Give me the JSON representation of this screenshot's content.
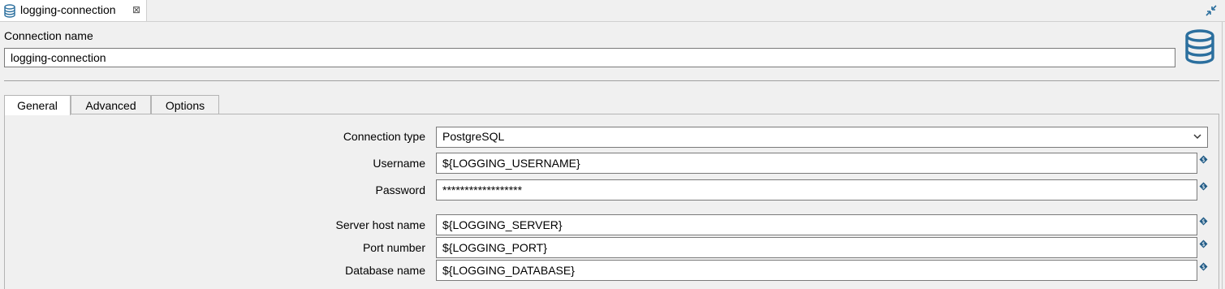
{
  "editor": {
    "tab_title": "logging-connection",
    "tab_close_glyph": "⊠",
    "tab_icon": "database-icon"
  },
  "connection_name": {
    "label": "Connection name",
    "value": "logging-connection"
  },
  "tabs": [
    {
      "label": "General",
      "active": true
    },
    {
      "label": "Advanced",
      "active": false
    },
    {
      "label": "Options",
      "active": false
    }
  ],
  "general": {
    "connection_type": {
      "label": "Connection type",
      "value": "PostgreSQL"
    },
    "username": {
      "label": "Username",
      "value": "${LOGGING_USERNAME}"
    },
    "password": {
      "label": "Password",
      "value": "******************"
    },
    "server_host": {
      "label": "Server host name",
      "value": "${LOGGING_SERVER}"
    },
    "port": {
      "label": "Port number",
      "value": "${LOGGING_PORT}"
    },
    "database": {
      "label": "Database name",
      "value": "${LOGGING_DATABASE}"
    }
  },
  "colors": {
    "accent_icon": "#2b6f9e",
    "variable_icon": "#1f5a85"
  }
}
